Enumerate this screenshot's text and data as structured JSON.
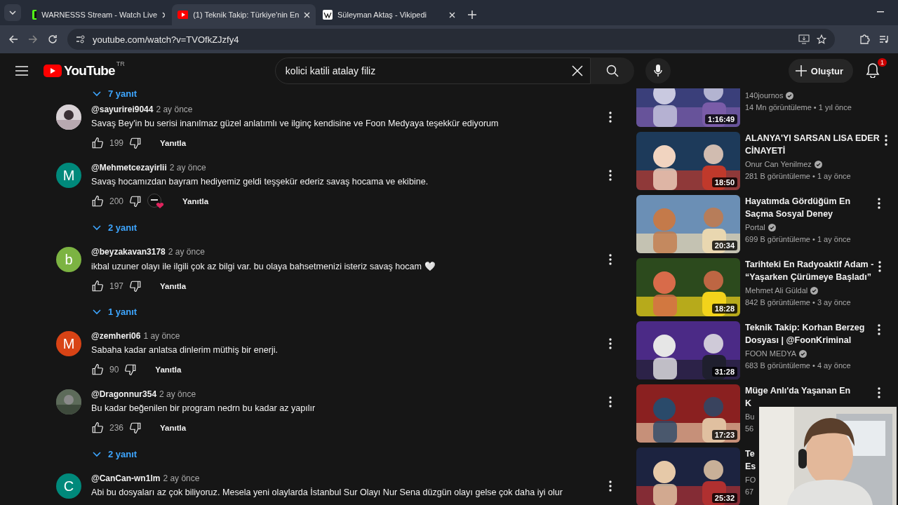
{
  "browser": {
    "tabs": [
      {
        "title": "WARNESSS Stream - Watch Live",
        "selected": false
      },
      {
        "title": "(1) Teknik Takip: Türkiye'nin En",
        "selected": true
      },
      {
        "title": "Süleyman Aktaş - Vikipedi",
        "selected": false
      }
    ],
    "url": "youtube.com/watch?v=TVOfkZJzfy4"
  },
  "header": {
    "logo": "YouTube",
    "region": "TR",
    "search": "kolici katili atalay filiz",
    "create": "Oluştur",
    "notifications": "1"
  },
  "comments": {
    "leading_replies": "7 yanıt",
    "items": [
      {
        "author": "@sayurirei9044",
        "time": "2 ay önce",
        "text": "Savaş Bey'in bu serisi inanılmaz güzel anlatımlı ve ilginç kendisine  ve Foon Medyaya teşekkür ediyorum",
        "likes": "199",
        "reply": "Yanıtla",
        "hearted": false
      },
      {
        "author": "@Mehmetcezayirlii",
        "time": "2 ay önce",
        "text": "Savaş hocamızdan bayram hediyemiz geldi teşşekür ederiz savaş hocama ve ekibine.",
        "likes": "200",
        "reply": "Yanıtla",
        "hearted": true,
        "replies": "2 yanıt",
        "avatar": {
          "kind": "letter",
          "letter": "M",
          "color": "#00897b"
        }
      },
      {
        "author": "@beyzakavan3178",
        "time": "2 ay önce",
        "text": "ikbal uzuner olayı ile ilgili çok az bilgi var. bu olaya bahsetmenizi isteriz savaş hocam 🤍",
        "likes": "197",
        "reply": "Yanıtla",
        "hearted": false,
        "replies": "1 yanıt",
        "avatar": {
          "kind": "letter",
          "letter": "b",
          "color": "#7cb342"
        }
      },
      {
        "author": "@zemheri06",
        "time": "1 ay önce",
        "text": "Sabaha kadar anlatsa dinlerim müthiş bir enerji.",
        "likes": "90",
        "reply": "Yanıtla",
        "hearted": false,
        "avatar": {
          "kind": "letter",
          "letter": "M",
          "color": "#d84315"
        }
      },
      {
        "author": "@Dragonnur354",
        "time": "2 ay önce",
        "text": "Bu kadar beğenilen bir program nedrn bu kadar az yapılır",
        "likes": "236",
        "reply": "Yanıtla",
        "hearted": false,
        "replies": "2 yanıt"
      },
      {
        "author": "@CanCan-wn1lm",
        "time": "2 ay önce",
        "text": "Abi bu dosyaları az çok biliyoruz. Mesela yeni olaylarda İstanbul Sur Olayı Nur Sena düzgün olayı gelse çok daha iyi olur",
        "avatar": {
          "kind": "letter",
          "letter": "C",
          "color": "#00897b"
        }
      }
    ]
  },
  "videos": [
    {
      "channel": "140journos",
      "verified": true,
      "stats": "14 Mn görüntüleme • 1 yıl önce",
      "duration": "1:16:49",
      "menu": false
    },
    {
      "title_lines": [
        "ALANYA'YI SARSAN LISA EDER",
        "CİNAYETİ"
      ],
      "channel": "Onur Can Yenilmez",
      "verified": true,
      "stats": "281 B görüntüleme • 1 ay önce",
      "duration": "18:50",
      "menu": true
    },
    {
      "title_lines": [
        "Hayatımda Gördüğüm En",
        "Saçma Sosyal Deney"
      ],
      "channel": "Portal",
      "verified": true,
      "stats": "699 B görüntüleme • 1 ay önce",
      "duration": "20:34",
      "menu": true
    },
    {
      "title_lines": [
        "Tarihteki En Radyoaktif Adam -",
        "“Yaşarken Çürümeye Başladı”"
      ],
      "channel": "Mehmet Ali Güldal",
      "verified": true,
      "stats": "842 B görüntüleme • 3 ay önce",
      "duration": "18:28",
      "menu": true
    },
    {
      "title_lines": [
        "Teknik Takip: Korhan Berzeg",
        "Dosyası | @FoonKriminal"
      ],
      "channel": "FOON MEDYA",
      "verified": true,
      "stats": "683 B görüntüleme • 4 ay önce",
      "duration": "31:28",
      "menu": true
    },
    {
      "title_lines": [
        "Müge Anlı'da Yaşanan En",
        "K"
      ],
      "channel": "Bu",
      "verified": false,
      "stats": "56",
      "duration": "17:23",
      "menu": true
    },
    {
      "title_lines": [
        "Te",
        "Es"
      ],
      "channel": "FO",
      "verified": false,
      "stats": "67",
      "duration": "25:32"
    }
  ]
}
